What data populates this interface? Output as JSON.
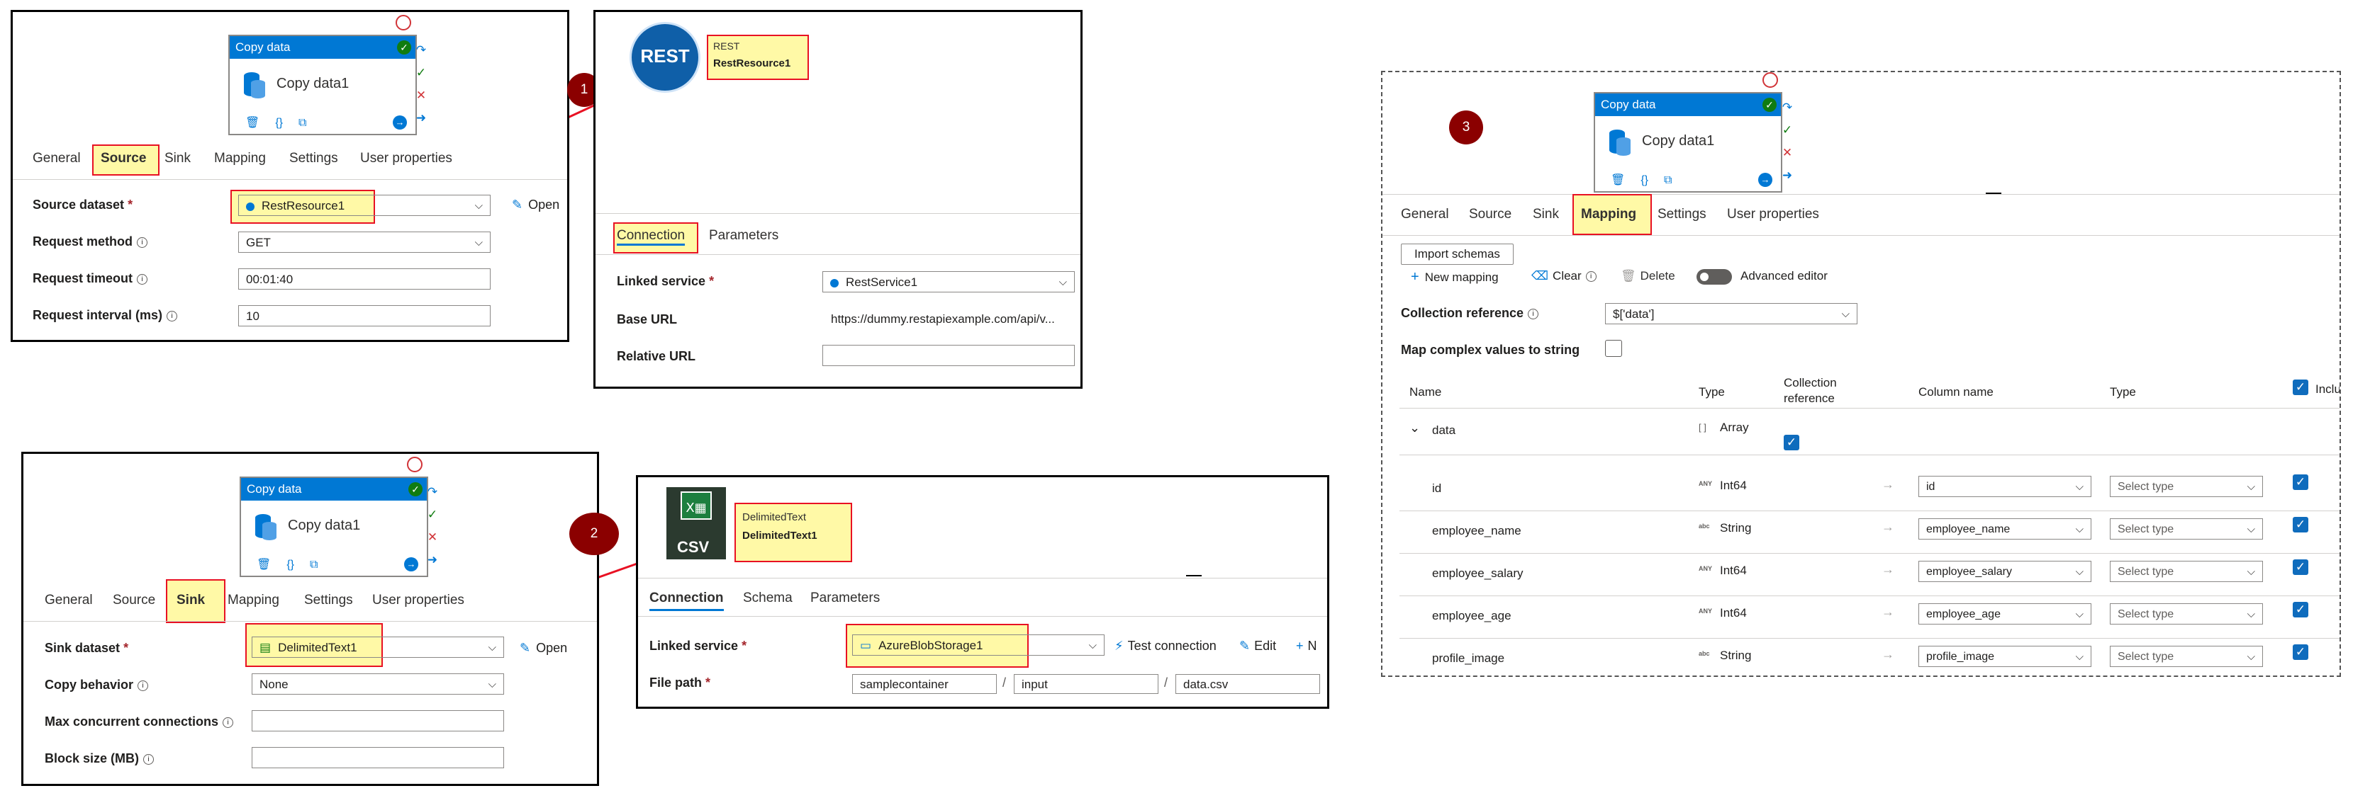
{
  "activity": {
    "header": "Copy data",
    "name": "Copy data1"
  },
  "tabs": {
    "general": "General",
    "source": "Source",
    "sink": "Sink",
    "mapping": "Mapping",
    "settings": "Settings",
    "user_properties": "User properties"
  },
  "source_panel": {
    "source_dataset_label": "Source dataset",
    "source_dataset_value": "RestResource1",
    "open_label": "Open",
    "request_method_label": "Request method",
    "request_method_value": "GET",
    "request_timeout_label": "Request timeout",
    "request_timeout_value": "00:01:40",
    "request_interval_label": "Request interval (ms)",
    "request_interval_value": "10"
  },
  "rest_panel": {
    "icon_text": "REST",
    "type": "REST",
    "name": "RestResource1",
    "tab_connection": "Connection",
    "tab_parameters": "Parameters",
    "linked_service_label": "Linked service",
    "linked_service_value": "RestService1",
    "base_url_label": "Base URL",
    "base_url_value": "https://dummy.restapiexample.com/api/v...",
    "relative_url_label": "Relative URL",
    "relative_url_value": ""
  },
  "sink_panel": {
    "sink_dataset_label": "Sink dataset",
    "sink_dataset_value": "DelimitedText1",
    "open_label": "Open",
    "copy_behavior_label": "Copy behavior",
    "copy_behavior_value": "None",
    "max_conn_label": "Max concurrent connections",
    "block_size_label": "Block size (MB)"
  },
  "csv_panel": {
    "icon_text": "CSV",
    "type": "DelimitedText",
    "name": "DelimitedText1",
    "tab_connection": "Connection",
    "tab_schema": "Schema",
    "tab_parameters": "Parameters",
    "linked_service_label": "Linked service",
    "linked_service_value": "AzureBlobStorage1",
    "test_connection": "Test connection",
    "edit": "Edit",
    "new_partial": "N",
    "file_path_label": "File path",
    "file_path": [
      "samplecontainer",
      "input",
      "data.csv"
    ]
  },
  "badges": [
    "1",
    "2",
    "3"
  ],
  "mapping_panel": {
    "import_schemas": "Import schemas",
    "new_mapping": "New mapping",
    "clear": "Clear",
    "delete": "Delete",
    "advanced_editor": "Advanced editor",
    "collection_reference_label": "Collection reference",
    "collection_reference_value": "$['data']",
    "map_complex_label": "Map complex values to string",
    "columns": {
      "name": "Name",
      "type": "Type",
      "collection_reference": "Collection reference",
      "column_name": "Column name",
      "type2": "Type",
      "include": "Inclu"
    },
    "group": {
      "name": "data",
      "type_icon": "[ ]",
      "type": "Array"
    },
    "select_type": "Select type",
    "rows": [
      {
        "name": "id",
        "type_icon": "ANY",
        "type": "Int64",
        "column": "id"
      },
      {
        "name": "employee_name",
        "type_icon": "abc",
        "type": "String",
        "column": "employee_name"
      },
      {
        "name": "employee_salary",
        "type_icon": "ANY",
        "type": "Int64",
        "column": "employee_salary"
      },
      {
        "name": "employee_age",
        "type_icon": "ANY",
        "type": "Int64",
        "column": "employee_age"
      },
      {
        "name": "profile_image",
        "type_icon": "abc",
        "type": "String",
        "column": "profile_image"
      }
    ]
  }
}
